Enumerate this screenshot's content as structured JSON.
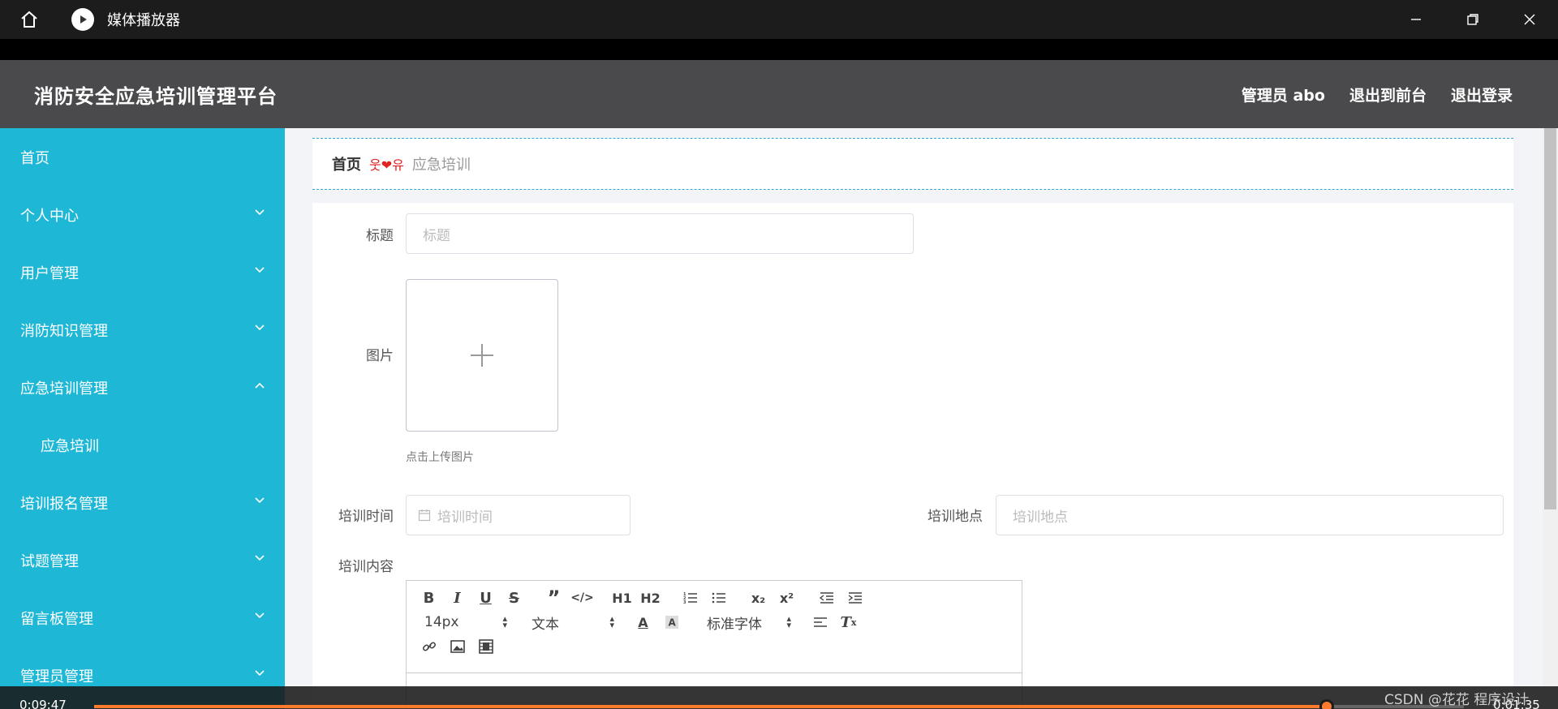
{
  "media_player": {
    "title": "媒体播放器",
    "elapsed": "0:09:47",
    "remaining": "0:01:35",
    "progress": 0.9,
    "watermark": "CSDN @花花 程序设计"
  },
  "app": {
    "brand": "消防安全应急培训管理平台",
    "user_label": "管理员 abo",
    "front_link": "退出到前台",
    "logout_link": "退出登录"
  },
  "sidebar": {
    "items": [
      {
        "label": "首页"
      },
      {
        "label": "个人中心"
      },
      {
        "label": "用户管理"
      },
      {
        "label": "消防知识管理"
      },
      {
        "label": "应急培训管理"
      },
      {
        "label": "应急培训"
      },
      {
        "label": "培训报名管理"
      },
      {
        "label": "试题管理"
      },
      {
        "label": "留言板管理"
      },
      {
        "label": "管理员管理"
      }
    ]
  },
  "breadcrumb": {
    "home": "首页",
    "separator": "웃❤유",
    "current": "应急培训"
  },
  "form": {
    "title_label": "标题",
    "title_placeholder": "标题",
    "image_label": "图片",
    "upload_hint": "点击上传图片",
    "time_label": "培训时间",
    "time_placeholder": "培训时间",
    "place_label": "培训地点",
    "place_placeholder": "培训地点",
    "content_label": "培训内容"
  },
  "editor": {
    "font_size": "14px",
    "text_style": "文本",
    "font_family": "标准字体",
    "h1": "H1",
    "h2": "H2",
    "sub": "x₂",
    "sup": "x²"
  },
  "colors": {
    "sidebar_bg": "#1fb7d6",
    "topnav_bg": "#4a4a4d",
    "progress": "#ff7a2b"
  }
}
